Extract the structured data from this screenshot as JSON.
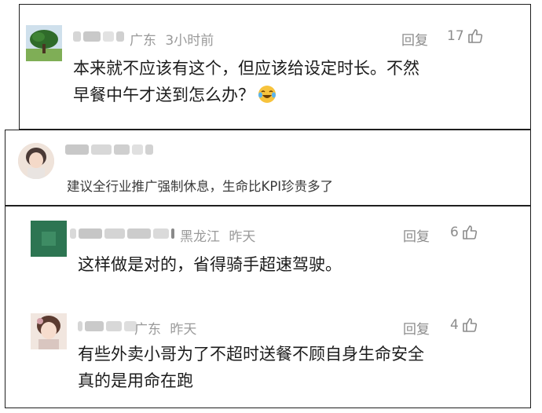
{
  "comments": [
    {
      "location": "广东",
      "time": "3小时前",
      "reply_label": "回复",
      "likes": "17",
      "text_line1": "本来就不应该有这个，但应该给设定时长。不然",
      "text_line2": "早餐中午才送到怎么办？",
      "emoji": "laughing-crying-emoji"
    },
    {
      "text": "建议全行业推广强制休息，生命比KPI珍贵多了"
    },
    {
      "location": "黑龙江",
      "time": "昨天",
      "reply_label": "回复",
      "likes": "6",
      "text": "这样做是对的，省得骑手超速驾驶。"
    },
    {
      "location": "广东",
      "time": "昨天",
      "reply_label": "回复",
      "likes": "4",
      "text_line1": "有些外卖小哥为了不超时送餐不顾自身生命安全",
      "text_line2": "真的是用命在跑"
    }
  ],
  "icons": {
    "like": "thumbs-up-icon"
  },
  "colors": {
    "meta_gray": "#9a9a9a",
    "text": "#1c1c1c",
    "border": "#1f1f1f"
  }
}
